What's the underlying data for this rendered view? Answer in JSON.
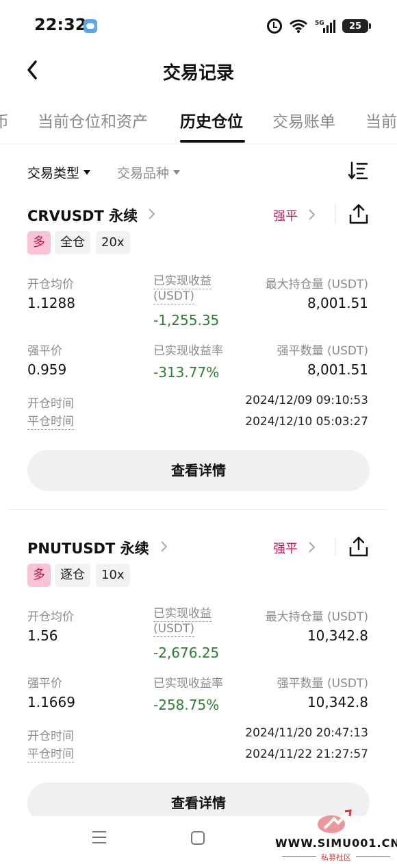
{
  "status_bar": {
    "time": "22:32",
    "network": "5G",
    "battery": "25"
  },
  "header": {
    "title": "交易记录"
  },
  "tabs": [
    {
      "label": "币"
    },
    {
      "label": "当前仓位和资产"
    },
    {
      "label": "历史仓位"
    },
    {
      "label": "交易账单"
    },
    {
      "label": "当前"
    }
  ],
  "active_tab": "历史仓位",
  "filters": {
    "type": "交易类型",
    "symbol": "交易品种"
  },
  "labels": {
    "avg_open": "开仓均价",
    "realized_pnl_line1": "已实现收益",
    "realized_pnl_line2": "(USDT)",
    "max_pos": "最大持仓量 (USDT)",
    "liq_price": "强平价",
    "realized_rate": "已实现收益率",
    "liq_qty": "强平数量 (USDT)",
    "open_time": "开仓时间",
    "close_time": "平仓时间",
    "detail_button": "查看详情"
  },
  "positions": [
    {
      "symbol": "CRVUSDT 永续",
      "status": "强平",
      "direction": "多",
      "margin_mode": "全仓",
      "leverage": "20x",
      "avg_open": "1.1288",
      "realized_pnl": "-1,255.35",
      "max_pos": "8,001.51",
      "liq_price": "0.959",
      "realized_rate": "-313.77%",
      "liq_qty": "8,001.51",
      "open_time": "2024/12/09 09:10:53",
      "close_time": "2024/12/10 05:03:27"
    },
    {
      "symbol": "PNUTUSDT 永续",
      "status": "强平",
      "direction": "多",
      "margin_mode": "逐仓",
      "leverage": "10x",
      "avg_open": "1.56",
      "realized_pnl": "-2,676.25",
      "max_pos": "10,342.8",
      "liq_price": "1.1669",
      "realized_rate": "-258.75%",
      "liq_qty": "10,342.8",
      "open_time": "2024/11/20 20:47:13",
      "close_time": "2024/11/22 21:27:57"
    }
  ],
  "watermark": {
    "url": "WWW.SIMU001.CN",
    "subtitle": "私募社区"
  },
  "colors": {
    "negative": "#2e7d32",
    "liquidation": "#c2185b",
    "long_tag_bg": "#f8c3d6"
  }
}
